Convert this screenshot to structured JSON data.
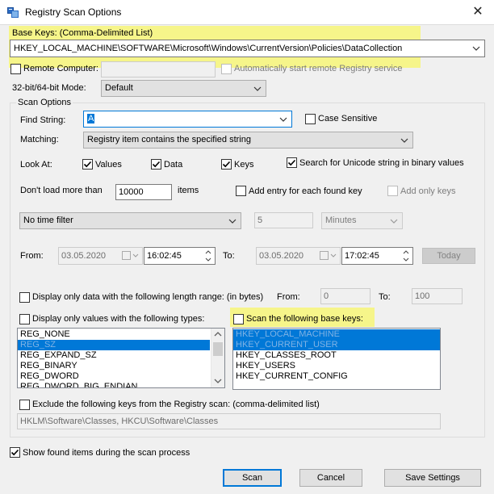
{
  "window": {
    "title": "Registry Scan Options",
    "close_glyph": "✕"
  },
  "base_keys": {
    "label": "Base Keys:  (Comma-Delimited List)",
    "value": "HKEY_LOCAL_MACHINE\\SOFTWARE\\Microsoft\\Windows\\CurrentVersion\\Policies\\DataCollection"
  },
  "remote": {
    "label": "Remote Computer:",
    "value": "",
    "auto_start_label": "Automatically start remote Registry service"
  },
  "mode": {
    "label": "32-bit/64-bit Mode:",
    "value": "Default"
  },
  "scan_options": {
    "group_title": "Scan Options",
    "find_string_label": "Find String:",
    "find_string_value": "A",
    "case_sensitive_label": "Case Sensitive",
    "matching_label": "Matching:",
    "matching_value": "Registry item contains the specified string",
    "look_at_label": "Look At:",
    "values_label": "Values",
    "data_label": "Data",
    "keys_label": "Keys",
    "unicode_label": "Search for Unicode string in binary values",
    "dont_load_label": "Don't load more than",
    "dont_load_value": "10000",
    "items_label": "items",
    "add_entry_label": "Add entry for each found key",
    "add_only_keys_label": "Add only keys",
    "time_filter_value": "No time filter",
    "time_amount_value": "5",
    "time_unit_value": "Minutes",
    "from_label": "From:",
    "from_date": "03.05.2020",
    "from_time": "16:02:45",
    "to_label": "To:",
    "to_date": "03.05.2020",
    "to_time": "17:02:45",
    "today_label": "Today",
    "length_range_label": "Display only data with the following length range: (in bytes)",
    "length_from_label": "From:",
    "length_from_value": "0",
    "length_to_label": "To:",
    "length_to_value": "100",
    "types_label": "Display only values with the following types:",
    "types": [
      {
        "label": "REG_NONE",
        "selected": false
      },
      {
        "label": "REG_SZ",
        "selected": true
      },
      {
        "label": "REG_EXPAND_SZ",
        "selected": false
      },
      {
        "label": "REG_BINARY",
        "selected": false
      },
      {
        "label": "REG_DWORD",
        "selected": false
      },
      {
        "label": "REG_DWORD_BIG_ENDIAN",
        "selected": false
      }
    ],
    "base_keys_scan_label": "Scan the following base keys:",
    "base_keys_list": [
      {
        "label": "HKEY_LOCAL_MACHINE",
        "selected": true
      },
      {
        "label": "HKEY_CURRENT_USER",
        "selected": true
      },
      {
        "label": "HKEY_CLASSES_ROOT",
        "selected": false
      },
      {
        "label": "HKEY_USERS",
        "selected": false
      },
      {
        "label": "HKEY_CURRENT_CONFIG",
        "selected": false
      }
    ],
    "exclude_label": "Exclude the following keys from the Registry scan: (comma-delimited list)",
    "exclude_value": "HKLM\\Software\\Classes, HKCU\\Software\\Classes"
  },
  "show_found_label": "Show found items during the scan process",
  "buttons": {
    "scan": "Scan",
    "cancel": "Cancel",
    "save": "Save Settings"
  },
  "colors": {
    "highlight": "#f6f58a",
    "selection": "#0078d7"
  }
}
